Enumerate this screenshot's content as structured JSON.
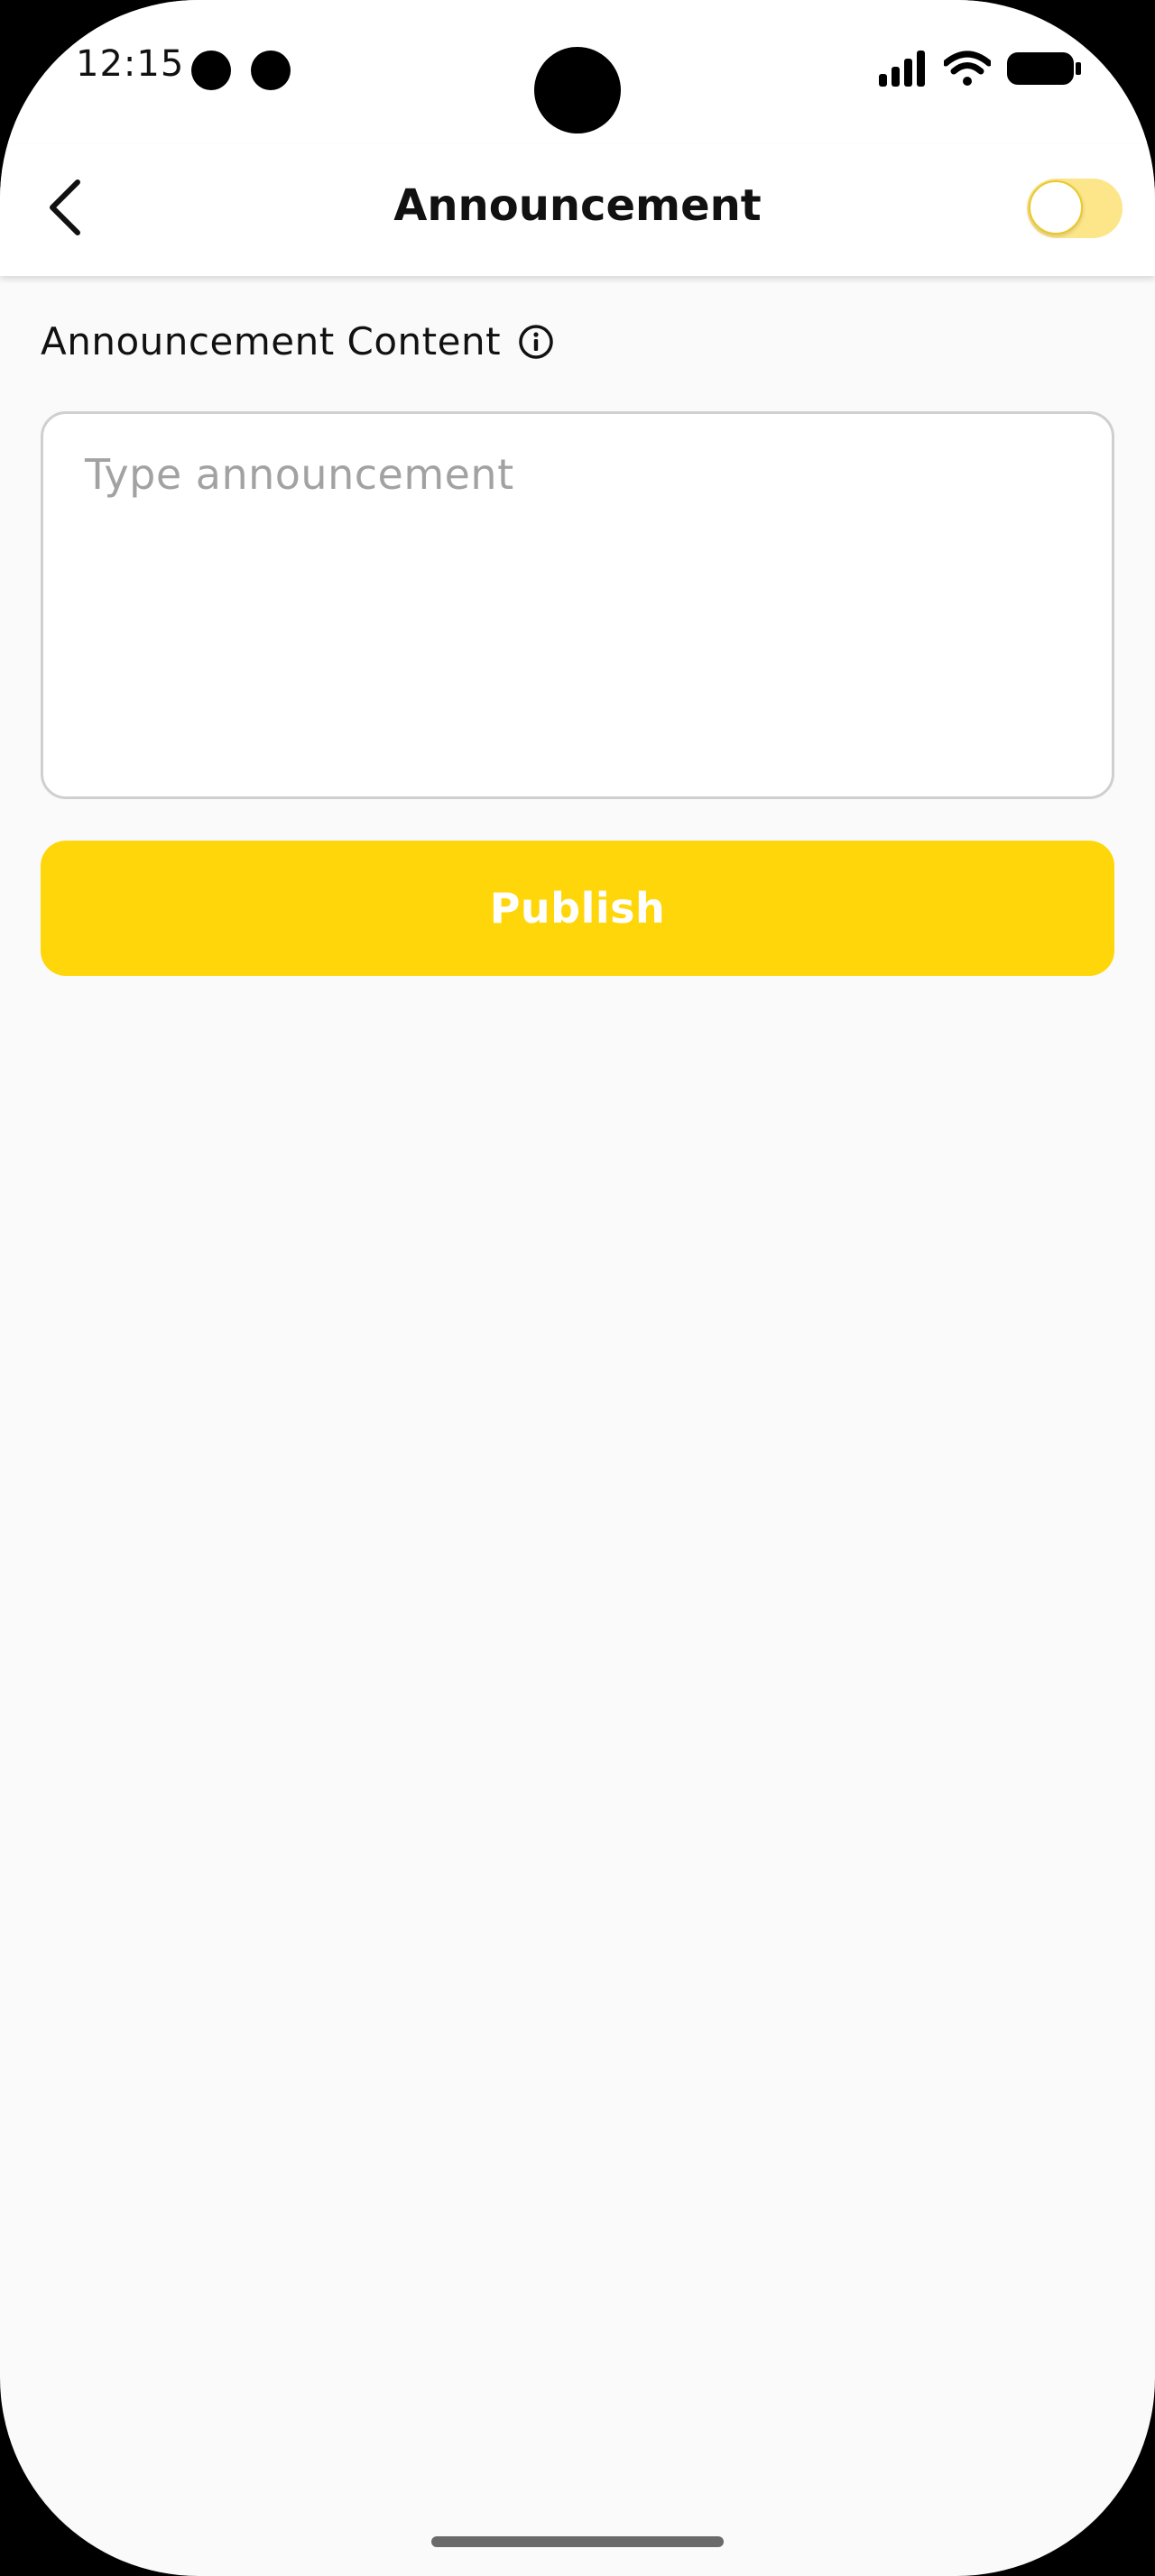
{
  "status_bar": {
    "time": "12:15",
    "icons": [
      "notification-dot-icon",
      "notification-dot-icon",
      "signal-icon",
      "wifi-icon",
      "battery-icon"
    ]
  },
  "app_bar": {
    "back_icon": "chevron-left-icon",
    "title": "Announcement",
    "toggle_on": false,
    "toggle_color": "#fde58a"
  },
  "form": {
    "label": "Announcement Content",
    "info_icon": "info-circle-icon",
    "textarea_value": "",
    "textarea_placeholder": "Type announcement",
    "publish_label": "Publish"
  },
  "colors": {
    "accent": "#ffd60a",
    "background": "#fafafa",
    "surface": "#ffffff",
    "placeholder": "#a2a2a2",
    "border": "#cfcfcf"
  }
}
